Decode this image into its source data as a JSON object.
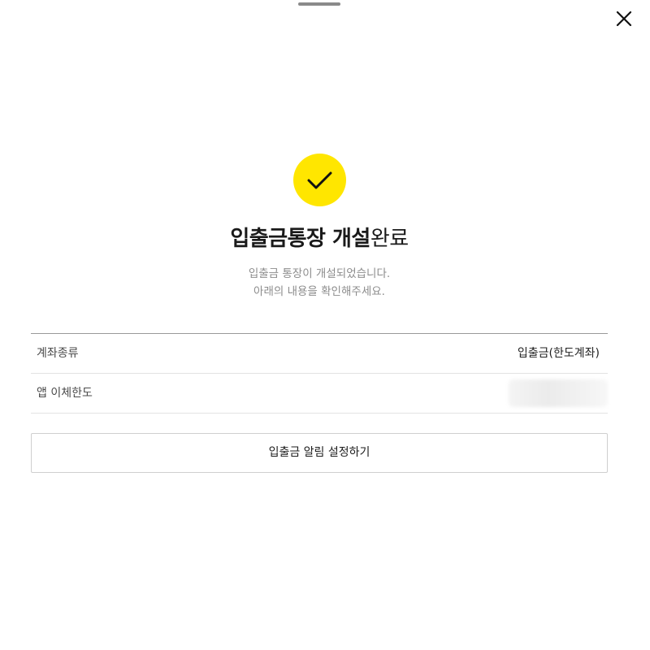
{
  "sheet": {
    "close_icon": "close-icon",
    "handle": "drag-handle"
  },
  "result": {
    "icon": "check-icon",
    "icon_color": "#ffe600",
    "title_bold": "입출금통장 개설",
    "title_light": "완료",
    "message_line1": "입출금 통장이 개설되었습니다.",
    "message_line2": "아래의 내용을 확인해주세요."
  },
  "details": {
    "rows": [
      {
        "label": "계좌종류",
        "value": "입출금(한도계좌)"
      },
      {
        "label": "앱 이체한도",
        "value": null
      }
    ]
  },
  "actions": {
    "alert_button_label": "입출금 알림 설정하기"
  }
}
